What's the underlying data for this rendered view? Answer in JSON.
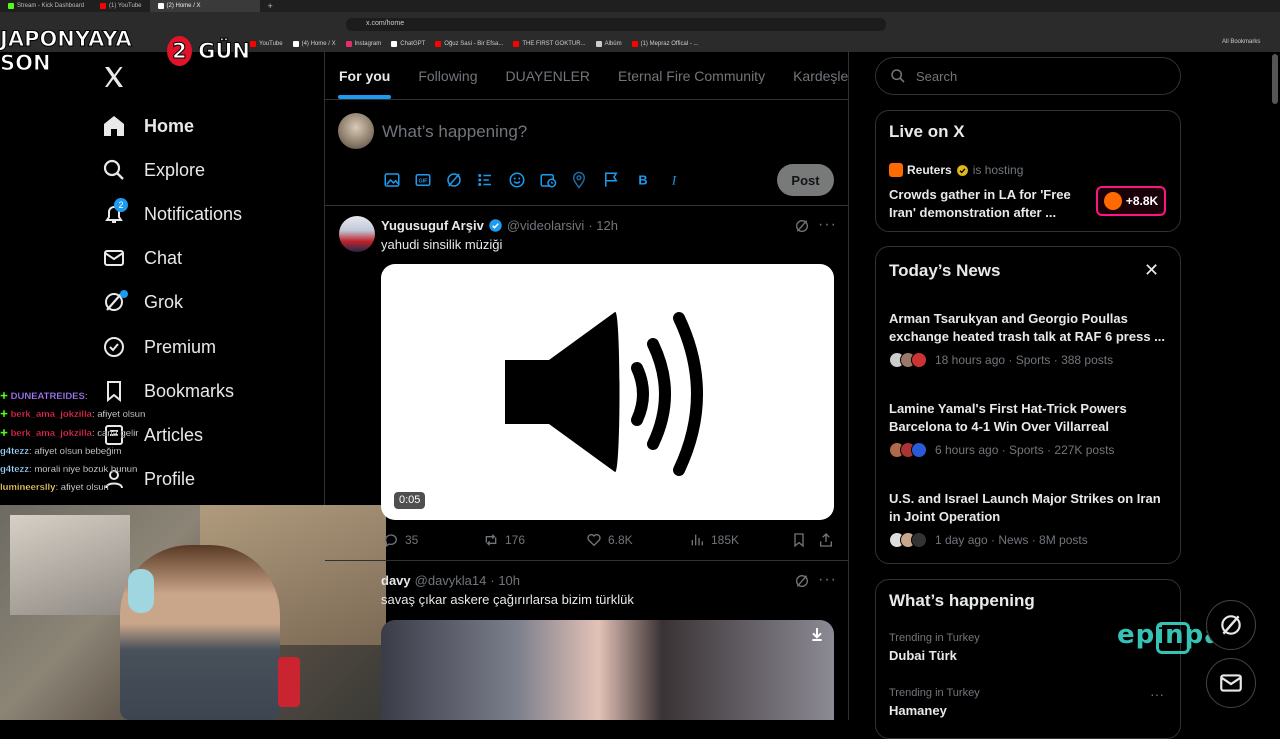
{
  "browser": {
    "tabs": [
      {
        "label": "Stream - Kick Dashboard",
        "color": "#53fc18"
      },
      {
        "label": "(1) YouTube",
        "color": "#ff0000"
      },
      {
        "label": "(2) Home / X",
        "color": "#ffffff"
      }
    ],
    "url": "x.com/home",
    "bookmarks": [
      {
        "label": "YouTube",
        "color": "#ff0000"
      },
      {
        "label": "(4) Home / X",
        "color": "#ffffff"
      },
      {
        "label": "Instagram",
        "color": "#e1306c"
      },
      {
        "label": "ChatGPT",
        "color": "#ffffff"
      },
      {
        "label": "Oğuz Sasi - Bir Efsa...",
        "color": "#ff0000"
      },
      {
        "label": "THE FIRST GOKTUR...",
        "color": "#ff0000"
      },
      {
        "label": "Albüm",
        "color": "#cccccc"
      },
      {
        "label": "(1) Mepraz Offical - ...",
        "color": "#ff0000"
      }
    ],
    "all_bookmarks": "All Bookmarks"
  },
  "overlay": {
    "countdown_left": "JAPONYAYA SON",
    "countdown_num": "2",
    "countdown_right": "GÜN",
    "chat": [
      {
        "user": "DUNEATREIDES",
        "msg": "",
        "color": "#a97cff"
      },
      {
        "user": "berk_ama_jokzilla",
        "msg": "afiyet olsun",
        "color": "#e22a4f"
      },
      {
        "user": "berk_ama_jokzilla",
        "msg": "cana gelir",
        "color": "#e22a4f"
      },
      {
        "user": "g4tezz",
        "msg": "afiyet olsun bebeğim",
        "color": "#9fd6ff"
      },
      {
        "user": "g4tezz",
        "msg": "morali niye bozuk bunun",
        "color": "#9fd6ff"
      },
      {
        "user": "lumineerslly",
        "msg": "afiyet olsun",
        "color": "#ffd86b"
      }
    ],
    "watermark": "epinpay"
  },
  "sidebar": {
    "items": [
      {
        "label": "Home",
        "icon": "home-icon"
      },
      {
        "label": "Explore",
        "icon": "search-icon"
      },
      {
        "label": "Notifications",
        "icon": "bell-icon",
        "badge": "2"
      },
      {
        "label": "Chat",
        "icon": "mail-icon"
      },
      {
        "label": "Grok",
        "icon": "grok-icon"
      },
      {
        "label": "Premium",
        "icon": "verified-icon"
      },
      {
        "label": "Bookmarks",
        "icon": "bookmark-icon"
      },
      {
        "label": "Articles",
        "icon": "article-icon"
      },
      {
        "label": "Profile",
        "icon": "person-icon"
      }
    ]
  },
  "timeline": {
    "tabs": [
      "For you",
      "Following",
      "DUAYENLER",
      "Eternal Fire Community",
      "Kardeşler K"
    ],
    "compose_placeholder": "What’s happening?",
    "post_label": "Post",
    "tweets": [
      {
        "name": "Yugusuguf Arşiv",
        "handle": "@videolarsivi",
        "time": "· 12h",
        "text": "yahudi sinsilik müziği",
        "duration": "0:05",
        "replies": "35",
        "reposts": "176",
        "likes": "6.8K",
        "views": "185K"
      },
      {
        "name": "davy",
        "handle": "@davykla14",
        "time": "· 10h",
        "text": "savaş çıkar askere çağırırlarsa bizim türklük"
      }
    ]
  },
  "right": {
    "search_placeholder": "Search",
    "live": {
      "title": "Live on X",
      "host": "Reuters",
      "hosting": "is hosting",
      "headline": "Crowds gather in LA for 'Free Iran' demonstration after ...",
      "count": "+8.8K"
    },
    "news": {
      "title": "Today’s News",
      "items": [
        {
          "title": "Arman Tsarukyan and Georgio Poullas exchange heated trash talk at RAF 6 press ...",
          "meta": "18 hours ago · Sports · 388 posts"
        },
        {
          "title": "Lamine Yamal's First Hat-Trick Powers Barcelona to 4-1 Win Over Villarreal",
          "meta": "6 hours ago · Sports · 227K posts"
        },
        {
          "title": "U.S. and Israel Launch Major Strikes on Iran in Joint Operation",
          "meta": "1 day ago · News · 8M posts"
        }
      ]
    },
    "happening": {
      "title": "What’s happening",
      "trends": [
        {
          "context": "Trending in Turkey",
          "name": "Dubai Türk"
        },
        {
          "context": "Trending in Turkey",
          "name": "Hamaney"
        }
      ]
    }
  },
  "colors": {
    "accent": "#1d9bf0",
    "live": "#f91880"
  }
}
